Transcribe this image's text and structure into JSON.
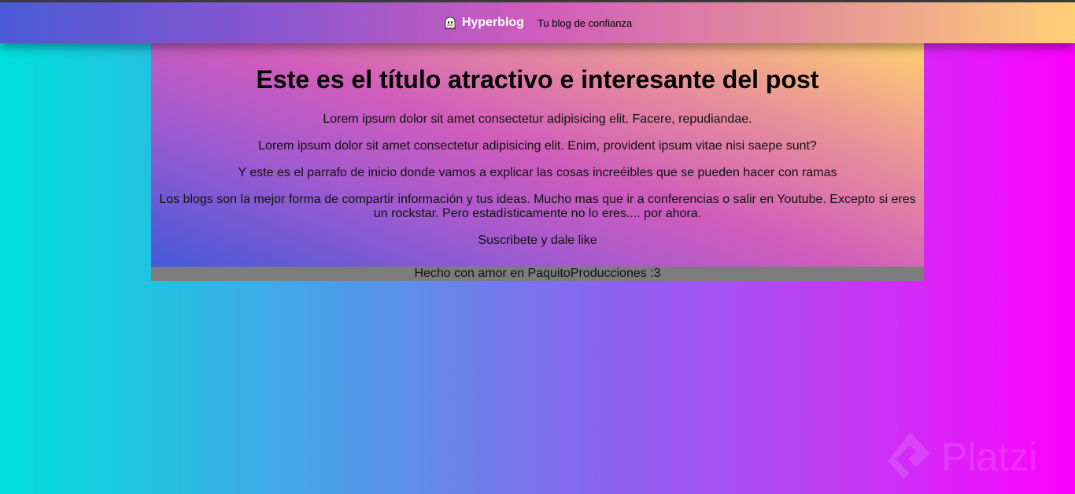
{
  "header": {
    "brand": "Hyperblog",
    "tagline": "Tu blog de confianza",
    "logo_icon": "ghost-icon"
  },
  "post": {
    "title": "Este es el título atractivo e interesante del post",
    "paragraphs": [
      "Lorem ipsum dolor sit amet consectetur adipisicing elit. Facere, repudiandae.",
      "Lorem ipsum dolor sit amet consectetur adipisicing elit. Enim, provident ipsum vitae nisi saepe sunt?",
      "Y este es el parrafo de inicio donde vamos a explicar las cosas increéibles que se pueden hacer con ramas",
      "Los blogs son la mejor forma de compartir información y tus ideas. Mucho mas que ir a conferencias o salir en Youtube. Excepto si eres un rockstar. Pero estadísticamente no lo eres.... por ahora.",
      "Suscribete y dale like"
    ]
  },
  "footer": {
    "text": "Hecho con amor en PaquitoProducciones :3"
  },
  "watermark": {
    "text": "Platzi",
    "icon": "platzi-logo-icon"
  },
  "colors": {
    "footer_bg": "#7c7c7c",
    "text": "#111111",
    "header_text": "#ffffff"
  }
}
